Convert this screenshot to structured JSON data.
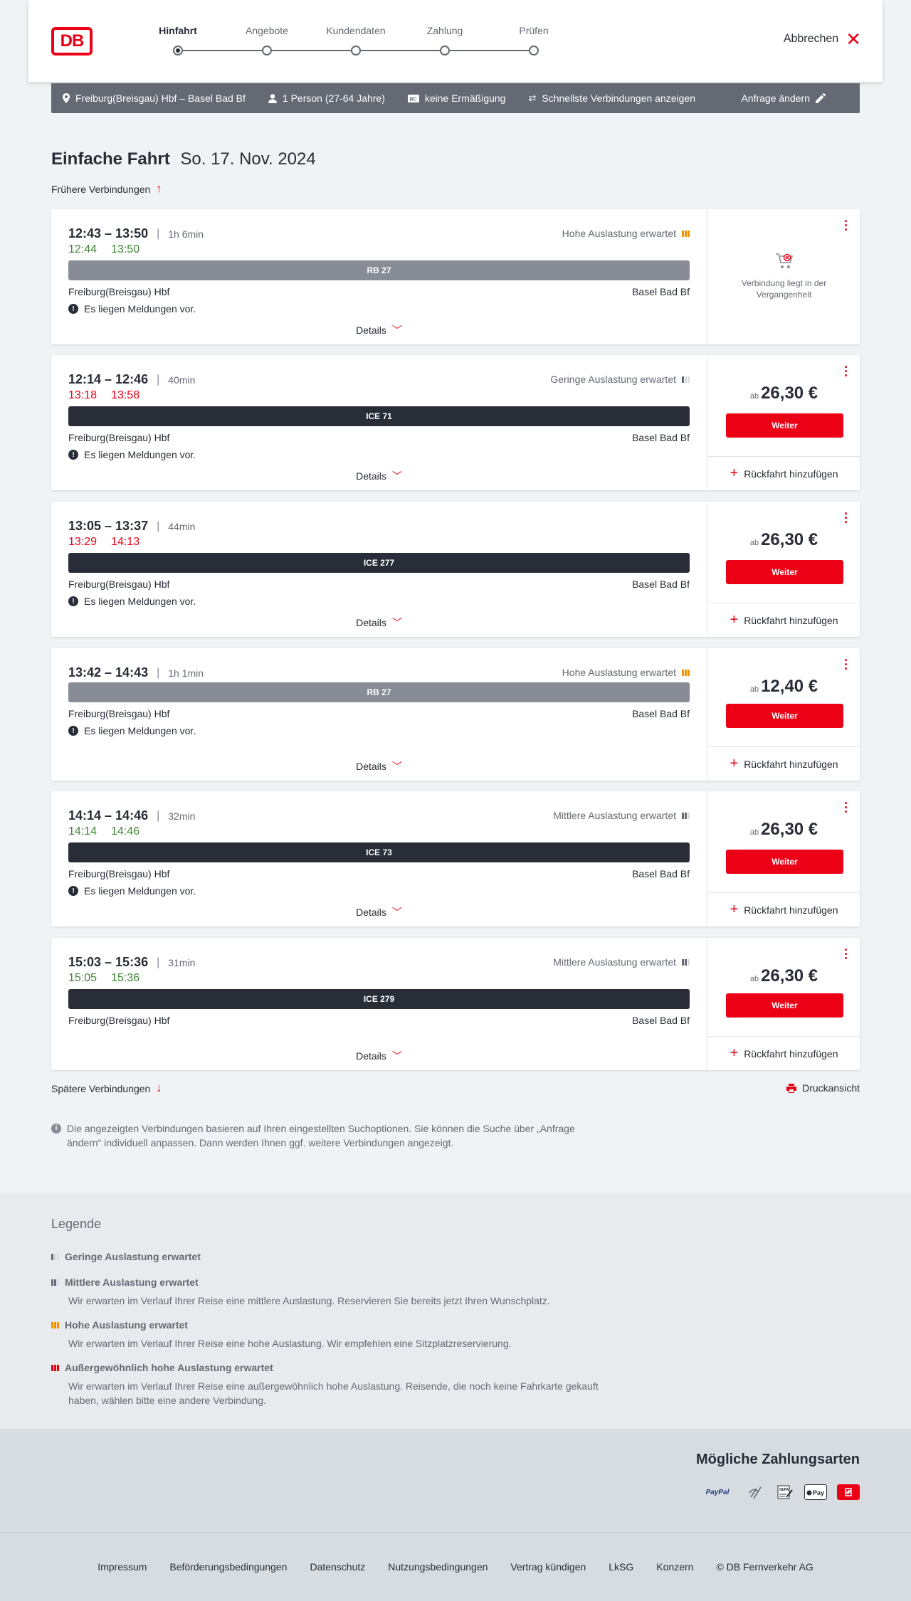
{
  "header": {
    "logo_text": "DB",
    "steps": [
      {
        "label": "Hinfahrt",
        "active": true
      },
      {
        "label": "Angebote",
        "active": false
      },
      {
        "label": "Kundendaten",
        "active": false
      },
      {
        "label": "Zahlung",
        "active": false
      },
      {
        "label": "Prüfen",
        "active": false
      }
    ],
    "cancel_label": "Abbrechen"
  },
  "query": {
    "route": "Freiburg(Breisgau) Hbf – Basel Bad Bf",
    "persons": "1 Person (27-64 Jahre)",
    "discount": "keine Ermäßigung",
    "fastest": "Schnellste Verbindungen anzeigen",
    "edit": "Anfrage ändern"
  },
  "title": {
    "type": "Einfache Fahrt",
    "date": "So. 17. Nov. 2024"
  },
  "earlier_label": "Frühere Verbindungen",
  "later_label": "Spätere Verbindungen",
  "print_label": "Druckansicht",
  "details_label": "Details",
  "weiter_label": "Weiter",
  "return_label": "Rückfahrt hinzufügen",
  "price_prefix": "ab",
  "past_label": "Verbindung liegt in der Vergangenheit",
  "connections": [
    {
      "times": "12:43 – 13:50",
      "duration": "1h 6min",
      "rt_dep": "12:44",
      "rt_arr": "13:50",
      "rt_color": "green",
      "occupancy": "Hohe Auslastung erwartet",
      "occ_level": "high",
      "train": "RB 27",
      "train_type": "rb",
      "from": "Freiburg(Breisgau) Hbf",
      "to": "Basel Bad Bf",
      "notice": "Es liegen Meldungen vor.",
      "price": "",
      "past": true
    },
    {
      "times": "12:14 – 12:46",
      "duration": "40min",
      "rt_dep": "13:18",
      "rt_arr": "13:58",
      "rt_color": "red",
      "occupancy": "Geringe Auslastung erwartet",
      "occ_level": "low",
      "train": "ICE 71",
      "train_type": "ice",
      "from": "Freiburg(Breisgau) Hbf",
      "to": "Basel Bad Bf",
      "notice": "Es liegen Meldungen vor.",
      "price": "26,30 €",
      "past": false
    },
    {
      "times": "13:05 – 13:37",
      "duration": "44min",
      "rt_dep": "13:29",
      "rt_arr": "14:13",
      "rt_color": "red",
      "occupancy": "",
      "occ_level": "",
      "train": "ICE 277",
      "train_type": "ice",
      "from": "Freiburg(Breisgau) Hbf",
      "to": "Basel Bad Bf",
      "notice": "Es liegen Meldungen vor.",
      "price": "26,30 €",
      "past": false
    },
    {
      "times": "13:42 – 14:43",
      "duration": "1h 1min",
      "rt_dep": "",
      "rt_arr": "",
      "rt_color": "",
      "occupancy": "Hohe Auslastung erwartet",
      "occ_level": "high",
      "train": "RB 27",
      "train_type": "rb",
      "from": "Freiburg(Breisgau) Hbf",
      "to": "Basel Bad Bf",
      "notice": "Es liegen Meldungen vor.",
      "price": "12,40 €",
      "past": false
    },
    {
      "times": "14:14 – 14:46",
      "duration": "32min",
      "rt_dep": "14:14",
      "rt_arr": "14:46",
      "rt_color": "green",
      "occupancy": "Mittlere Auslastung erwartet",
      "occ_level": "mid",
      "train": "ICE 73",
      "train_type": "ice",
      "from": "Freiburg(Breisgau) Hbf",
      "to": "Basel Bad Bf",
      "notice": "Es liegen Meldungen vor.",
      "price": "26,30 €",
      "past": false
    },
    {
      "times": "15:03 – 15:36",
      "duration": "31min",
      "rt_dep": "15:05",
      "rt_arr": "15:36",
      "rt_color": "green",
      "occupancy": "Mittlere Auslastung erwartet",
      "occ_level": "mid",
      "train": "ICE 279",
      "train_type": "ice",
      "from": "Freiburg(Breisgau) Hbf",
      "to": "Basel Bad Bf",
      "notice": "",
      "price": "26,30 €",
      "past": false
    }
  ],
  "info_text": "Die angezeigten Verbindungen basieren auf Ihren eingestellten Suchoptionen. Sie können die Suche über „Anfrage ändern“ individuell anpassen. Dann werden Ihnen ggf. weitere Verbindungen angezeigt.",
  "legend": {
    "title": "Legende",
    "items": [
      {
        "level": "low",
        "title": "Geringe Auslastung erwartet",
        "text": ""
      },
      {
        "level": "mid",
        "title": "Mittlere Auslastung erwartet",
        "text": "Wir erwarten im Verlauf Ihrer Reise eine mittlere Auslastung. Reservieren Sie bereits jetzt Ihren Wunschplatz."
      },
      {
        "level": "high",
        "title": "Hohe Auslastung erwartet",
        "text": "Wir erwarten im Verlauf Ihrer Reise eine hohe Auslastung. Wir empfehlen eine Sitzplatzreservierung."
      },
      {
        "level": "extreme",
        "title": "Außergewöhnlich hohe Auslastung erwartet",
        "text": "Wir erwarten im Verlauf Ihrer Reise eine außergewöhnlich hohe Auslastung. Reisende, die noch keine Fahrkarte gekauft haben, wählen bitte eine andere Verbindung."
      }
    ]
  },
  "payment": {
    "title": "Mögliche Zahlungsarten",
    "methods": [
      "PayPal",
      "Kreditkarte",
      "SEPA Lastschrift",
      "Apple Pay",
      "DB"
    ]
  },
  "footer": {
    "links": [
      "Impressum",
      "Beförderungsbedingungen",
      "Datenschutz",
      "Nutzungsbedingungen",
      "Vertrag kündigen",
      "LkSG",
      "Konzern",
      "© DB Fernverkehr AG"
    ]
  },
  "colors": {
    "brand": "#ec0016",
    "green": "#408335",
    "high_occupancy": "#f39200",
    "querybar": "#646973"
  }
}
